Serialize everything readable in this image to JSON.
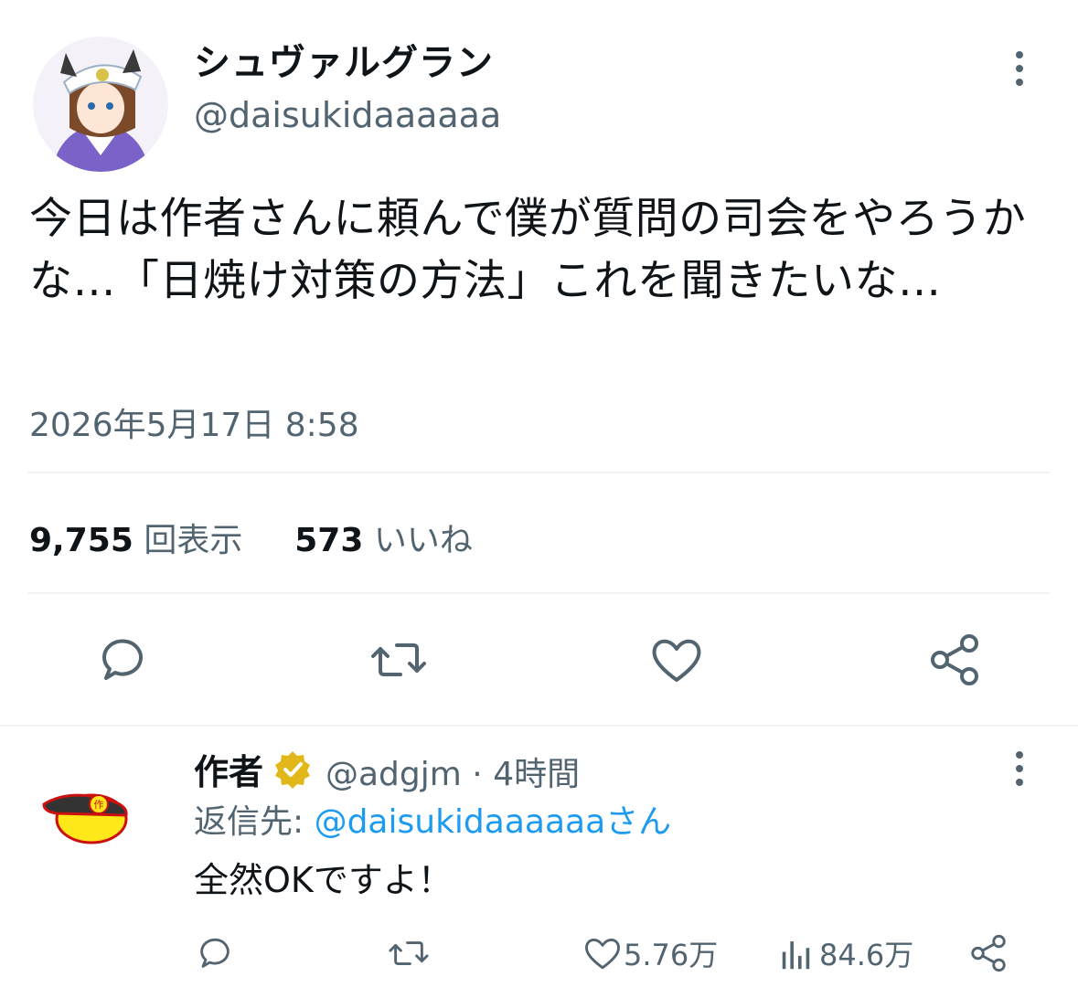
{
  "tweet": {
    "display_name": "シュヴァルグラン",
    "handle": "@daisukidaaaaaa",
    "text": "今日は作者さんに頼んで僕が質問の司会をやろうかな…「日焼け対策の方法」これを聞きたいな…",
    "timestamp": "2026年5月17日 8:58",
    "views_count": "9,755",
    "views_label": "回表示",
    "likes_count": "573",
    "likes_label": "いいね"
  },
  "reply": {
    "name": "作者",
    "handle": "@adgjm",
    "separator": "·",
    "time": "4時間",
    "reply_prefix": "返信先: ",
    "reply_target": "@daisukidaaaaaaさん",
    "text": "全然OKですよ！",
    "likes": "5.76万",
    "views": "84.6万",
    "avatar_char": "作"
  },
  "icons": {
    "more": "more-vertical-icon",
    "reply": "reply-icon",
    "retweet": "retweet-icon",
    "like": "heart-icon",
    "share": "share-icon",
    "verified": "verified-badge-icon",
    "analytics": "analytics-icon"
  },
  "colors": {
    "text": "#0f1419",
    "secondary": "#536471",
    "link": "#1d9bf0",
    "verified_gold": "#e2b719"
  }
}
